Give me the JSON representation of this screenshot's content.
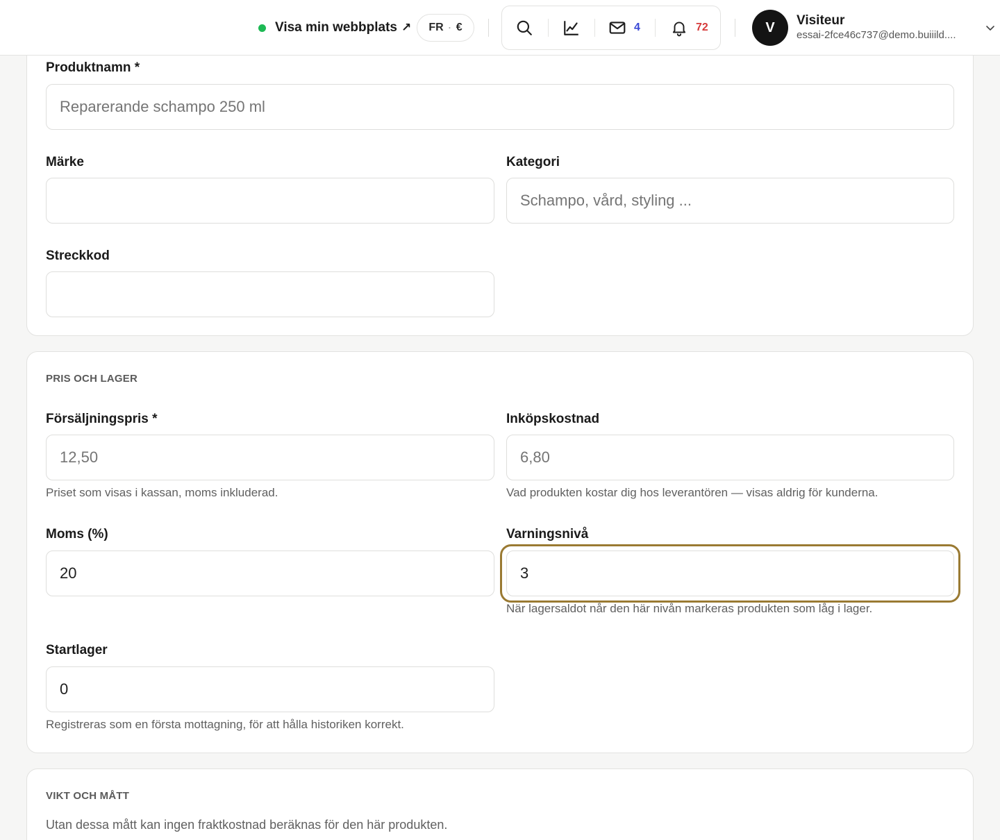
{
  "header": {
    "site_link_label": "Visa min webbplats",
    "site_link_arrow": "↗",
    "locale": "FR",
    "currency": "€",
    "messages_count": "4",
    "notifications_count": "72",
    "user": {
      "initial": "V",
      "name": "Visiteur",
      "email": "essai-2fce46c737@demo.buiiild...."
    },
    "status_color": "#1db954",
    "messages_count_color": "#3a49d6",
    "notifications_count_color": "#d63b3b"
  },
  "product": {
    "name_label": "Produktnamn *",
    "name_placeholder": "Reparerande schampo 250 ml",
    "brand_label": "Märke",
    "brand_value": "",
    "category_label": "Kategori",
    "category_placeholder": "Schampo, vård, styling ...",
    "barcode_label": "Streckkod",
    "barcode_value": ""
  },
  "pricing": {
    "title": "PRIS OCH LAGER",
    "sale_price_label": "Försäljningspris *",
    "sale_price_placeholder": "12,50",
    "sale_price_hint": "Priset som visas i kassan, moms inkluderad.",
    "cost_label": "Inköpskostnad",
    "cost_placeholder": "6,80",
    "cost_hint": "Vad produkten kostar dig hos leverantören — visas aldrig för kunderna.",
    "vat_label": "Moms (%)",
    "vat_value": "20",
    "alert_label": "Varningsnivå",
    "alert_value": "3",
    "alert_hint": "När lagersaldot når den här nivån markeras produkten som låg i lager.",
    "stock_label": "Startlager",
    "stock_value": "0",
    "stock_hint": "Registreras som en första mottagning, för att hålla historiken korrekt.",
    "focus_color": "#9a7a32"
  },
  "dimensions": {
    "title": "VIKT OCH MÅTT",
    "hint": "Utan dessa mått kan ingen fraktkostnad beräknas för den här produkten."
  }
}
